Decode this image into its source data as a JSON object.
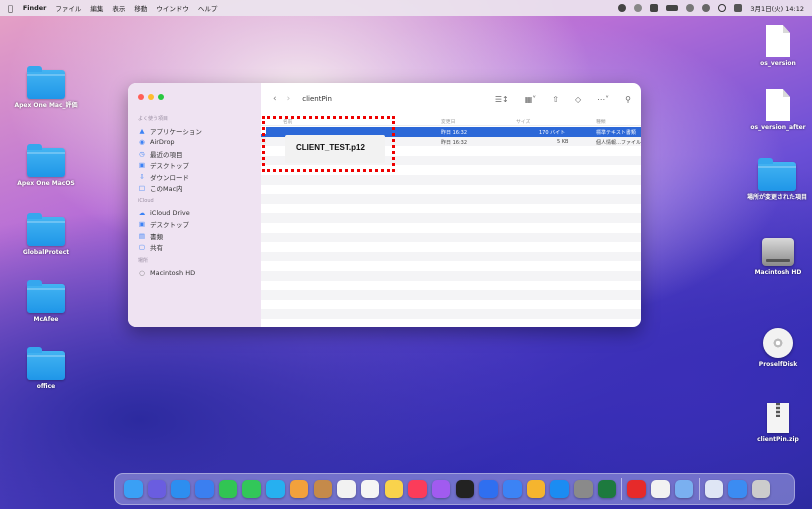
{
  "menubar": {
    "app": "Finder",
    "menus": [
      "ファイル",
      "編集",
      "表示",
      "移動",
      "ウインドウ",
      "ヘルプ"
    ],
    "clock": "3月1日(火) 14:12"
  },
  "desktop_left": [
    {
      "label": "Apex One Mac_評価",
      "icon": "folder"
    },
    {
      "label": "Apex One MacOS",
      "icon": "folder"
    },
    {
      "label": "GlobalProtect",
      "icon": "folder"
    },
    {
      "label": "McAfee",
      "icon": "folder"
    },
    {
      "label": "office",
      "icon": "folder"
    }
  ],
  "desktop_right": [
    {
      "label": "os_version",
      "icon": "document"
    },
    {
      "label": "os_version_after",
      "icon": "document"
    },
    {
      "label": "場所が変更された項目",
      "icon": "folder"
    },
    {
      "label": "Macintosh HD",
      "icon": "hard-drive"
    },
    {
      "label": "ProselfDisk",
      "icon": "disc"
    },
    {
      "label": "clientPin.zip",
      "icon": "zip"
    }
  ],
  "finder": {
    "title": "clientPin",
    "sidebar": {
      "favorites_label": "よく使う項目",
      "favorites": [
        "アプリケーション",
        "AirDrop",
        "最近の項目",
        "デスクトップ",
        "ダウンロード",
        "このMac内"
      ],
      "icloud_label": "iCloud",
      "icloud": [
        "iCloud Drive",
        "デスクトップ",
        "書類",
        "共有"
      ],
      "locations_label": "場所",
      "locations": [
        "Macintosh HD"
      ]
    },
    "columns": {
      "name": "名前",
      "date": "変更日",
      "size": "サイズ",
      "kind": "種類"
    },
    "files": [
      {
        "date": "昨日 16:32",
        "size": "170 バイト",
        "kind": "標準テキスト書類"
      },
      {
        "date": "昨日 16:32",
        "size": "5 KB",
        "kind": "個人情報…ファイル"
      }
    ]
  },
  "annotation": {
    "text": "CLIENT_TEST.p12",
    "color": "#e00000"
  },
  "dock": {
    "apps": [
      "#3aa0f5",
      "#6a5de0",
      "#2d8ef0",
      "#3b7ff0",
      "#31c553",
      "#32c759",
      "#26b0f0",
      "#f2a13c",
      "#c58a4a",
      "#f2f2f2",
      "#f5f5f5",
      "#f9d34c",
      "#fb3c5a",
      "#a15bf0",
      "#222222",
      "#2f6ff0",
      "#3c83f5",
      "#f5b52e",
      "#1b8cf2",
      "#8a8a8a",
      "#1d7a3e",
      "#e62a2a",
      "#f2f2f2",
      "#7ab0f0",
      "#dfe6f5",
      "#3b8cf2",
      "#cccccc"
    ]
  }
}
